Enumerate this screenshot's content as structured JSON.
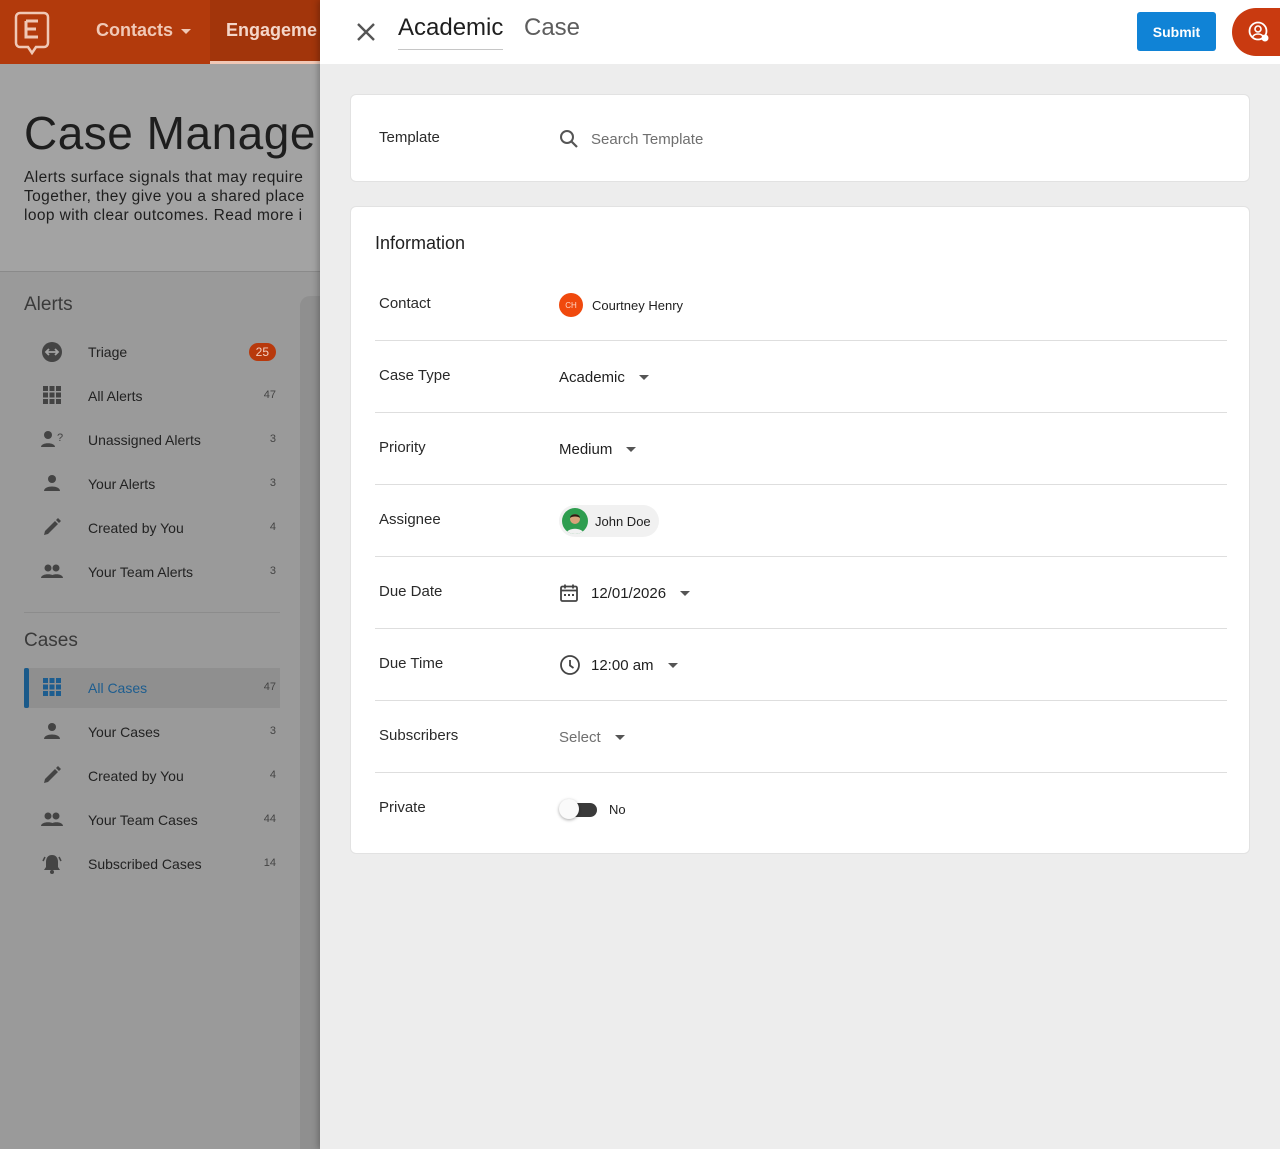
{
  "app": {
    "brand_icon": "e-logo-icon",
    "nav": {
      "contacts": "Contacts",
      "engagement": "Engageme"
    },
    "page_title": "Case Manage",
    "description_lines": [
      "Alerts surface signals that may require",
      "Together, they give you a shared place",
      "loop with clear outcomes. Read more i"
    ]
  },
  "sidebar": {
    "alerts_heading": "Alerts",
    "alerts": [
      {
        "label": "Triage",
        "count": "25",
        "icon": "triage-icon"
      },
      {
        "label": "All Alerts",
        "count": "47",
        "icon": "grid-icon"
      },
      {
        "label": "Unassigned Alerts",
        "count": "3",
        "icon": "person-question-icon"
      },
      {
        "label": "Your Alerts",
        "count": "3",
        "icon": "person-icon"
      },
      {
        "label": "Created by You",
        "count": "4",
        "icon": "pencil-icon"
      },
      {
        "label": "Your Team Alerts",
        "count": "3",
        "icon": "group-icon"
      }
    ],
    "cases_heading": "Cases",
    "cases": [
      {
        "label": "All Cases",
        "count": "47",
        "icon": "grid-icon",
        "active": true
      },
      {
        "label": "Your Cases",
        "count": "3",
        "icon": "person-icon"
      },
      {
        "label": "Created by You",
        "count": "4",
        "icon": "pencil-icon"
      },
      {
        "label": "Your Team Cases",
        "count": "44",
        "icon": "group-icon"
      },
      {
        "label": "Subscribed Cases",
        "count": "14",
        "icon": "bell-icon"
      }
    ]
  },
  "drawer": {
    "tabs": [
      "Academic",
      "Case"
    ],
    "submit_label": "Submit",
    "template": {
      "label": "Template",
      "placeholder": "Search Template"
    },
    "info_title": "Information",
    "fields": {
      "contact": {
        "label": "Contact",
        "initials": "CH",
        "value": "Courtney Henry"
      },
      "case_type": {
        "label": "Case Type",
        "value": "Academic"
      },
      "priority": {
        "label": "Priority",
        "value": "Medium"
      },
      "assignee": {
        "label": "Assignee",
        "value": "John Doe"
      },
      "due_date": {
        "label": "Due Date",
        "value": "12/01/2026"
      },
      "due_time": {
        "label": "Due Time",
        "value": "12:00 am"
      },
      "subscribers": {
        "label": "Subscribers",
        "value": "Select"
      },
      "private": {
        "label": "Private",
        "value": "No",
        "enabled": false
      }
    }
  },
  "colors": {
    "brand": "#b23a0c",
    "accent": "#1083d6",
    "avatar_orange": "#f0490d"
  }
}
